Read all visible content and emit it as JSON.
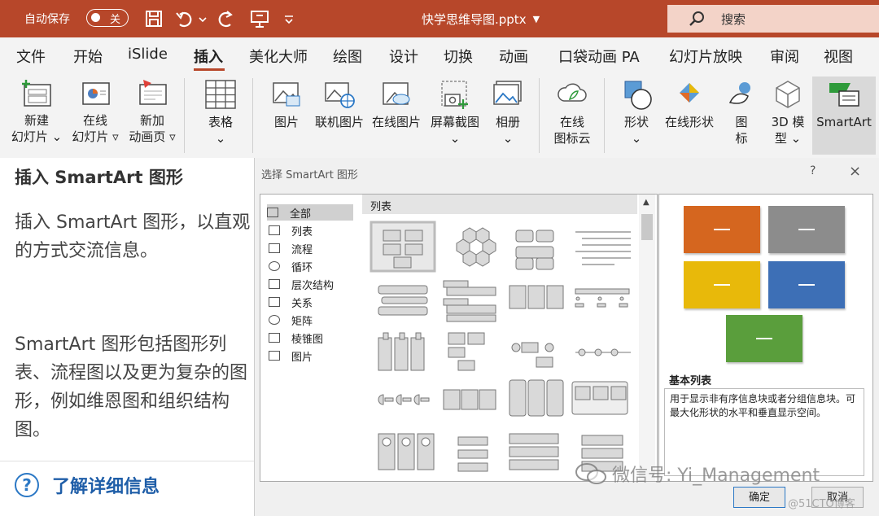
{
  "titlebar": {
    "autosave_label": "自动保存",
    "autosave_state": "关",
    "doc_title": "快学思维导图.pptx",
    "search_placeholder": "搜索"
  },
  "tabs": [
    "文件",
    "开始",
    "iSlide",
    "插入",
    "美化大师",
    "绘图",
    "设计",
    "切换",
    "动画",
    "口袋动画 PA",
    "幻灯片放映",
    "审阅",
    "视图"
  ],
  "active_tab": "插入",
  "ribbon": {
    "new_slide": [
      "新建",
      "幻灯片"
    ],
    "online_slide": [
      "在线",
      "幻灯片"
    ],
    "new_anim_page": [
      "新加",
      "动画页"
    ],
    "table": "表格",
    "picture": "图片",
    "online_picture": "联机图片",
    "online_picture2": "在线图片",
    "screenshot": "屏幕截图",
    "album": "相册",
    "icon_cloud": [
      "在线",
      "图标云"
    ],
    "shapes": "形状",
    "online_shapes": "在线形状",
    "icons": [
      "图",
      "标"
    ],
    "model_3d": [
      "3D 模",
      "型"
    ],
    "smartart": "SmartArt"
  },
  "tooltip": {
    "title": "插入 SmartArt 图形",
    "body1": "插入 SmartArt 图形，以直观的方式交流信息。",
    "body2": "SmartArt 图形包括图形列表、流程图以及更为复杂的图形，例如维恩图和组织结构图。",
    "link": "了解详细信息"
  },
  "dialog": {
    "title": "选择 SmartArt 图形",
    "help": "?",
    "close": "×",
    "categories": [
      "全部",
      "列表",
      "流程",
      "循环",
      "层次结构",
      "关系",
      "矩阵",
      "棱锥图",
      "图片"
    ],
    "selected_category": "全部",
    "layout_header": "列表",
    "preview_name": "基本列表",
    "preview_desc": "用于显示非有序信息块或者分组信息块。可最大化形状的水平和垂直显示空间。",
    "ok": "确定",
    "cancel": "取消"
  },
  "preview_colors": [
    "#d5661f",
    "#8c8c8c",
    "#e8b90a",
    "#3d6fb6",
    "#5a9e3c"
  ],
  "watermark": "微信号: Yi_Management",
  "watermark2": "@51CTO博客"
}
